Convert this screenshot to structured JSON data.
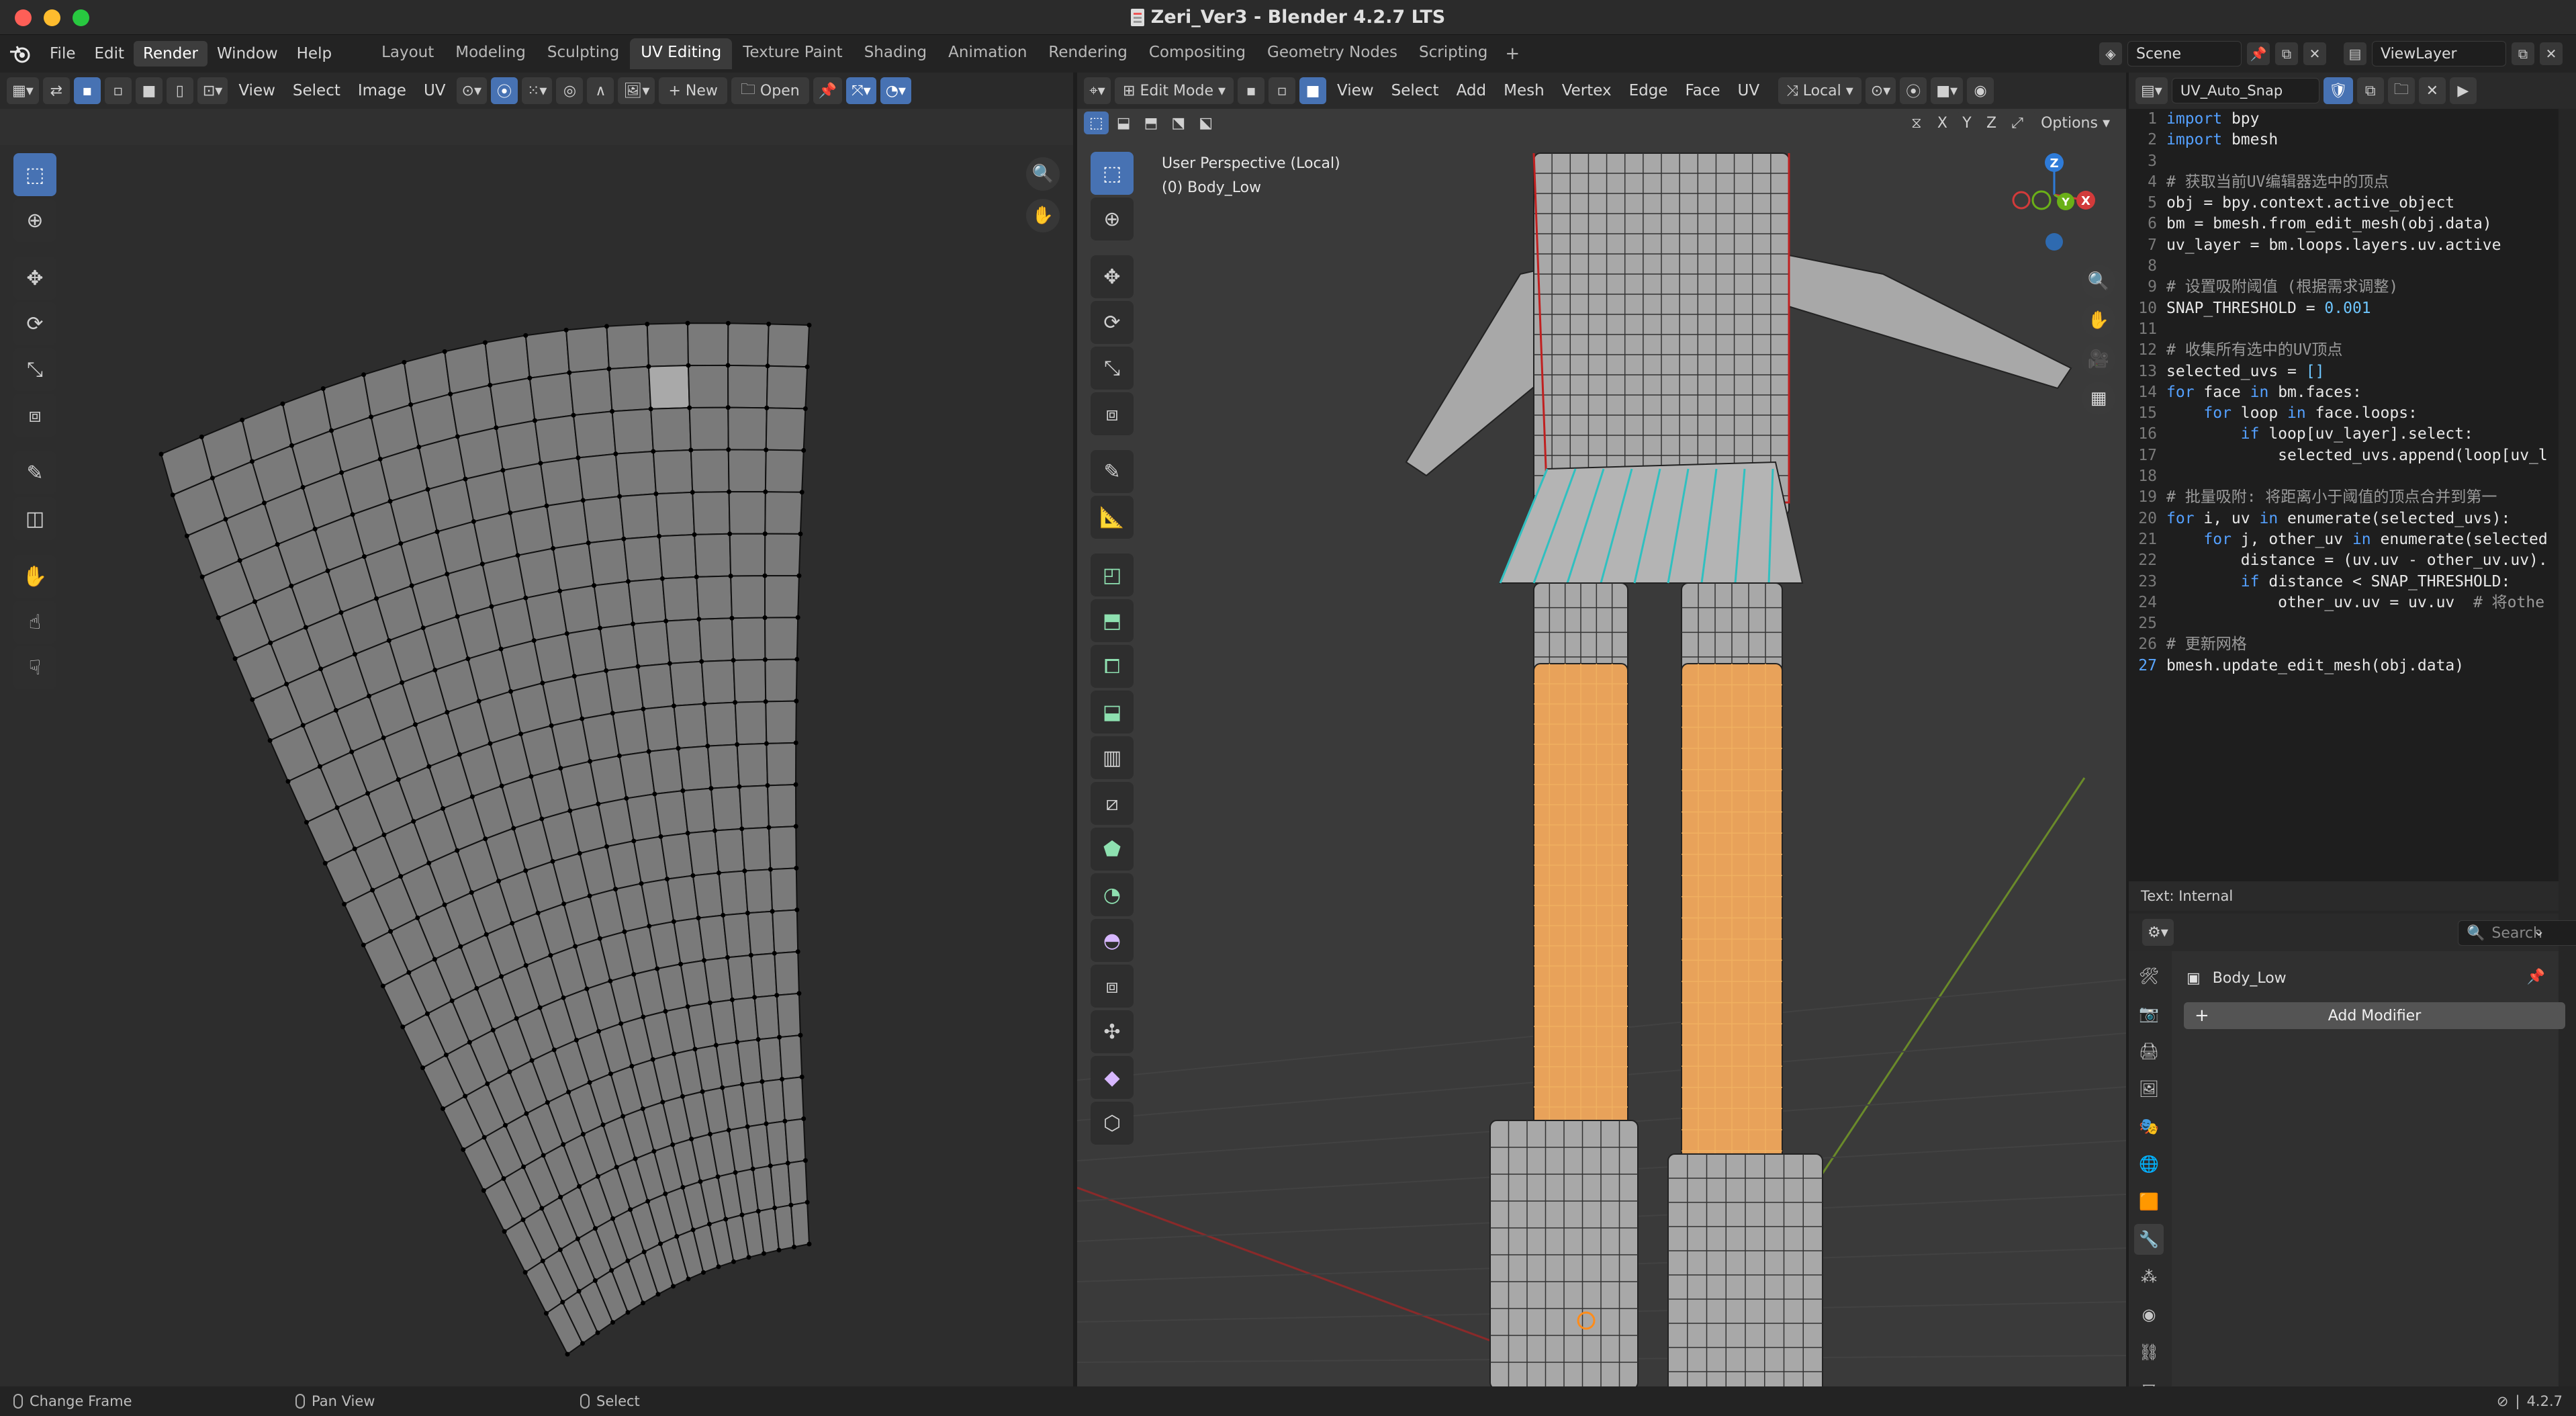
{
  "window": {
    "title": "Zeri_Ver3 - Blender 4.2.7 LTS"
  },
  "menus": [
    "File",
    "Edit",
    "Render",
    "Window",
    "Help"
  ],
  "menus_active": "Render",
  "workspaces": [
    "Layout",
    "Modeling",
    "Sculpting",
    "UV Editing",
    "Texture Paint",
    "Shading",
    "Animation",
    "Rendering",
    "Compositing",
    "Geometry Nodes",
    "Scripting"
  ],
  "workspace_active": "UV Editing",
  "workspace_add": "+",
  "scene": {
    "name": "Scene",
    "view_layer": "ViewLayer"
  },
  "uv_editor": {
    "menus": [
      "View",
      "Select",
      "Image",
      "UV"
    ],
    "new_label": "New",
    "open_label": "Open"
  },
  "viewport": {
    "mode": "Edit Mode",
    "menus": [
      "View",
      "Select",
      "Add",
      "Mesh",
      "Vertex",
      "Edge",
      "Face",
      "UV"
    ],
    "transform_orientation": "Local",
    "info_line1": "User Perspective (Local)",
    "info_line2": "(0) Body_Low",
    "axis_x": "X",
    "axis_y": "Y",
    "axis_z": "Z",
    "options_label": "Options",
    "gizmo": {
      "x": "X",
      "y": "Y",
      "z": "Z"
    }
  },
  "text_editor": {
    "file_name": "UV_Auto_Snap",
    "status": "Text: Internal",
    "lines": [
      "import bpy",
      "import bmesh",
      "",
      "# 获取当前UV编辑器选中的顶点",
      "obj = bpy.context.active_object",
      "bm = bmesh.from_edit_mesh(obj.data)",
      "uv_layer = bm.loops.layers.uv.active",
      "",
      "# 设置吸附阈值 (根据需求调整)",
      "SNAP_THRESHOLD = 0.001",
      "",
      "# 收集所有选中的UV顶点",
      "selected_uvs = []",
      "for face in bm.faces:",
      "    for loop in face.loops:",
      "        if loop[uv_layer].select:",
      "            selected_uvs.append(loop[uv_l",
      "",
      "# 批量吸附: 将距离小于阈值的顶点合并到第一",
      "for i, uv in enumerate(selected_uvs):",
      "    for j, other_uv in enumerate(selected",
      "        distance = (uv.uv - other_uv.uv).",
      "        if distance < SNAP_THRESHOLD:",
      "            other_uv.uv = uv.uv  # 将othe",
      "",
      "# 更新网格",
      "bmesh.update_edit_mesh(obj.data)"
    ],
    "current_line": 27
  },
  "properties": {
    "search_placeholder": "Search",
    "object_name": "Body_Low",
    "add_modifier": "Add Modifier"
  },
  "statusbar": {
    "left": "Change Frame",
    "middle": "Pan View",
    "right": "Select",
    "version": "4.2.7"
  },
  "colors": {
    "accent": "#4772b3",
    "selected_mesh": "#f0a040",
    "seam": "#d02020",
    "sharp": "#30c0c0"
  }
}
